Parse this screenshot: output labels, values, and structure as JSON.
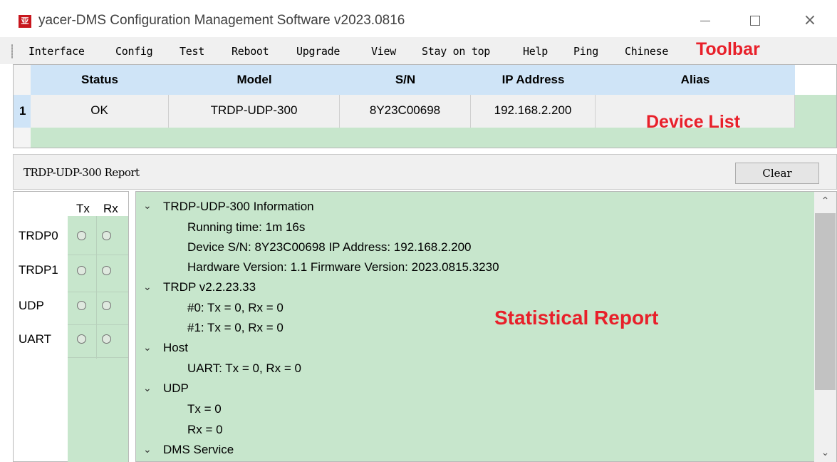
{
  "window": {
    "icon_text": "亚",
    "title": "yacer-DMS Configuration Management Software v2023.0816",
    "minimize_label": "",
    "maximize_label": "",
    "close_label": "×"
  },
  "toolbar": {
    "items": [
      "Interface",
      "Config",
      "Test",
      "Reboot",
      "Upgrade",
      "View",
      "Stay on top",
      "Help",
      "Ping",
      "Chinese"
    ],
    "annotation": "Toolbar"
  },
  "device_list": {
    "columns": [
      "Status",
      "Model",
      "S/N",
      "IP Address",
      "Alias"
    ],
    "rows": [
      {
        "num": "1",
        "status": "OK",
        "model": "TRDP-UDP-300",
        "sn": "8Y23C00698",
        "ip": "192.168.2.200",
        "alias": ""
      }
    ],
    "annotation": "Device List"
  },
  "report": {
    "title": "TRDP-UDP-300 Report",
    "clear_label": "Clear"
  },
  "status_table": {
    "tx_header": "Tx",
    "rx_header": "Rx",
    "rows": [
      "TRDP0",
      "TRDP1",
      "UDP",
      "UART"
    ]
  },
  "tree": {
    "info": {
      "header": "TRDP-UDP-300 Information",
      "running_time": "Running time: 1m 16s",
      "device_line": "Device S/N: 8Y23C00698    IP Address: 192.168.2.200",
      "version_line": "Hardware Version: 1.1    Firmware Version: 2023.0815.3230"
    },
    "trdp": {
      "header": "TRDP    v2.2.23.33",
      "line0": "#0: Tx = 0, Rx = 0",
      "line1": "#1: Tx = 0, Rx = 0"
    },
    "host": {
      "header": "Host",
      "uart": "UART: Tx = 0, Rx = 0"
    },
    "udp": {
      "header": "UDP",
      "tx": "Tx = 0",
      "rx": "Rx = 0"
    },
    "dms": {
      "header": "DMS Service"
    },
    "annotation": "Statistical Report"
  },
  "colors": {
    "header_blue": "#cfe4f7",
    "panel_green": "#c7e6cc",
    "annotation_red": "#e8202a"
  }
}
